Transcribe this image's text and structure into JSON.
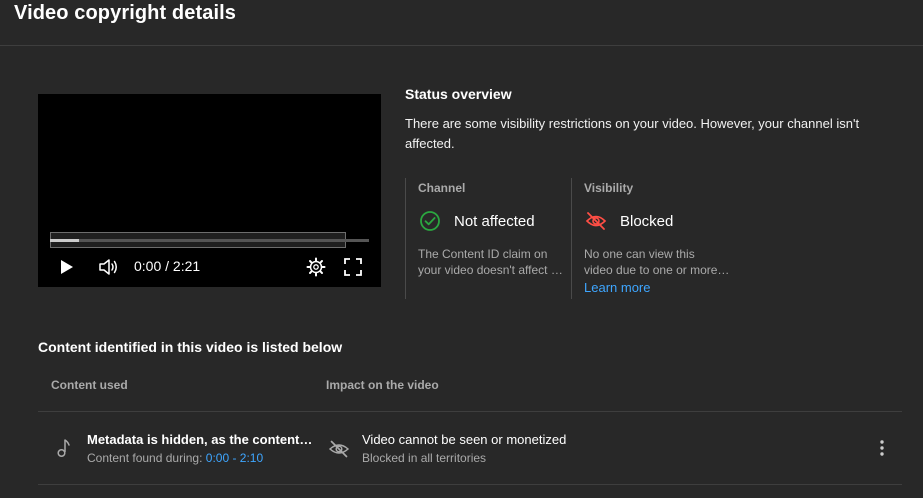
{
  "header": {
    "title": "Video copyright details"
  },
  "player": {
    "time": "0:00 / 2:21",
    "progress_fraction": 0.09
  },
  "status": {
    "title": "Status overview",
    "description": "There are some visibility restrictions on your video. However, your channel isn't affected.",
    "channel": {
      "label": "Channel",
      "value": "Not affected",
      "text_line1": "The Content ID claim on",
      "text_line2": "your video doesn't affect your channel",
      "icon": "check-circle-icon",
      "color": "#2ba640"
    },
    "visibility": {
      "label": "Visibility",
      "value": "Blocked",
      "text_line1": "No one can view this",
      "text_line2": "video due to one or more claims",
      "link": "Learn more",
      "icon": "eye-off-icon",
      "color": "#ff4e45"
    }
  },
  "content": {
    "section_title": "Content identified in this video is listed below",
    "columns": {
      "content_used": "Content used",
      "impact": "Impact on the video"
    },
    "rows": [
      {
        "title": "Metadata is hidden, as the content in this video",
        "found_label": "Content found during:",
        "found_range": "0:00 - 2:10",
        "impact_title": "Video cannot be seen or monetized",
        "impact_sub": "Blocked in all territories",
        "icon": "music-note-icon",
        "impact_icon": "eye-off-icon"
      }
    ]
  },
  "colors": {
    "background": "#282828",
    "accent_link": "#3ea6ff",
    "success": "#2ba640",
    "error": "#ff4e45"
  }
}
